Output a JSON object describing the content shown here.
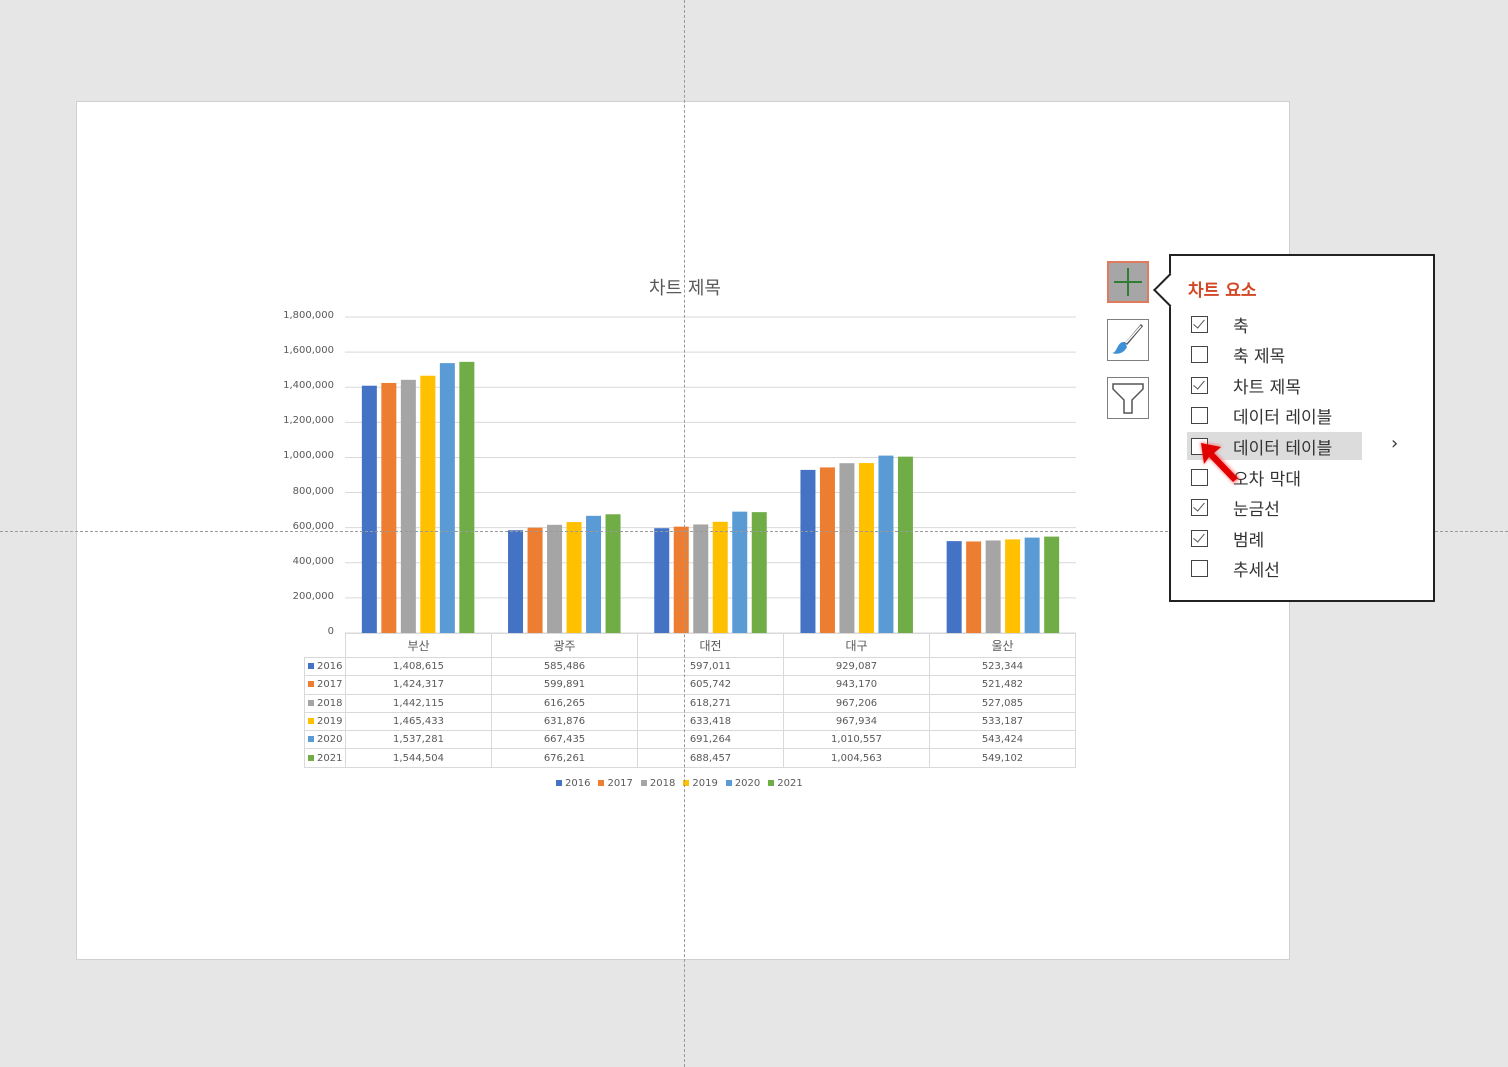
{
  "chart": {
    "title": "차트 제목",
    "y_ticks": [
      "0",
      "200,000",
      "400,000",
      "600,000",
      "800,000",
      "1,000,000",
      "1,200,000",
      "1,400,000",
      "1,600,000",
      "1,800,000"
    ],
    "y_max": 1800000
  },
  "chart_data": {
    "type": "bar",
    "title": "차트 제목",
    "categories": [
      "부산",
      "광주",
      "대전",
      "대구",
      "울산"
    ],
    "ylim": [
      0,
      1800000
    ],
    "grid": true,
    "legend": "bottom",
    "series": [
      {
        "name": "2016",
        "color": "#4472c4",
        "values": [
          1408615,
          585486,
          597011,
          929087,
          523344
        ],
        "labels": [
          "1,408,615",
          "585,486",
          "597,011",
          "929,087",
          "523,344"
        ]
      },
      {
        "name": "2017",
        "color": "#ed7d31",
        "values": [
          1424317,
          599891,
          605742,
          943170,
          521482
        ],
        "labels": [
          "1,424,317",
          "599,891",
          "605,742",
          "943,170",
          "521,482"
        ]
      },
      {
        "name": "2018",
        "color": "#a5a5a5",
        "values": [
          1442115,
          616265,
          618271,
          967206,
          527085
        ],
        "labels": [
          "1,442,115",
          "616,265",
          "618,271",
          "967,206",
          "527,085"
        ]
      },
      {
        "name": "2019",
        "color": "#ffc000",
        "values": [
          1465433,
          631876,
          633418,
          967934,
          533187
        ],
        "labels": [
          "1,465,433",
          "631,876",
          "633,418",
          "967,934",
          "533,187"
        ]
      },
      {
        "name": "2020",
        "color": "#5b9bd5",
        "values": [
          1537281,
          667435,
          691264,
          1010557,
          543424
        ],
        "labels": [
          "1,537,281",
          "667,435",
          "691,264",
          "1,010,557",
          "543,424"
        ]
      },
      {
        "name": "2021",
        "color": "#70ad47",
        "values": [
          1544504,
          676261,
          688457,
          1004563,
          549102
        ],
        "labels": [
          "1,544,504",
          "676,261",
          "688,457",
          "1,004,563",
          "549,102"
        ]
      }
    ]
  },
  "panel": {
    "title": "차트 요소",
    "items": [
      {
        "label": "축",
        "checked": true
      },
      {
        "label": "축 제목",
        "checked": false
      },
      {
        "label": "차트 제목",
        "checked": true
      },
      {
        "label": "데이터 레이블",
        "checked": false
      },
      {
        "label": "데이터 테이블",
        "checked": false,
        "submenu": true
      },
      {
        "label": "오차 막대",
        "checked": false
      },
      {
        "label": "눈금선",
        "checked": true
      },
      {
        "label": "범례",
        "checked": true
      },
      {
        "label": "추세선",
        "checked": false
      }
    ],
    "chevron": "›"
  },
  "icons": {
    "add": "plus-icon",
    "style": "brush-icon",
    "filter": "funnel-icon"
  }
}
